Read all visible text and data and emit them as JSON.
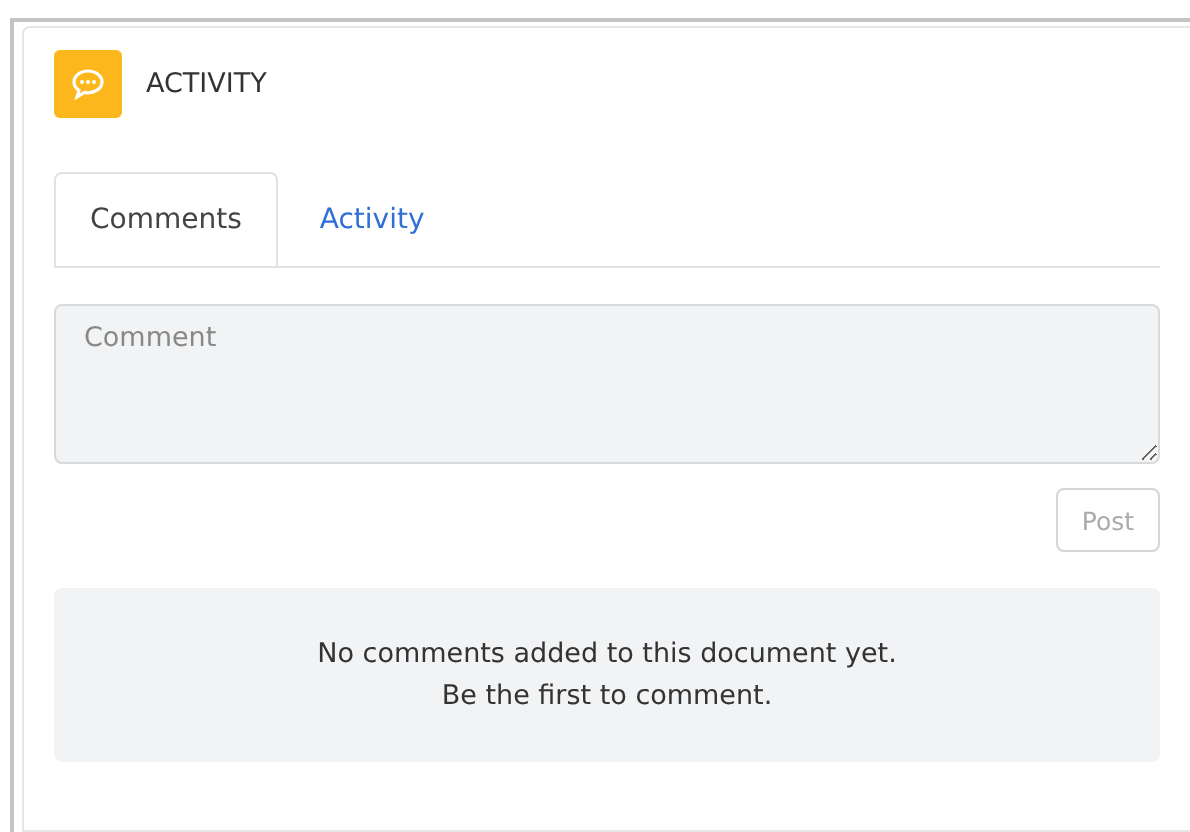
{
  "panel": {
    "title": "ACTIVITY"
  },
  "tabs": [
    {
      "label": "Comments",
      "selected": true
    },
    {
      "label": "Activity",
      "selected": false
    }
  ],
  "comment_field": {
    "placeholder": "Comment"
  },
  "post_button": {
    "label": "Post",
    "disabled": true
  },
  "empty_state": {
    "lines": [
      "No comments added to this document yet.",
      "Be the first to comment."
    ]
  }
}
